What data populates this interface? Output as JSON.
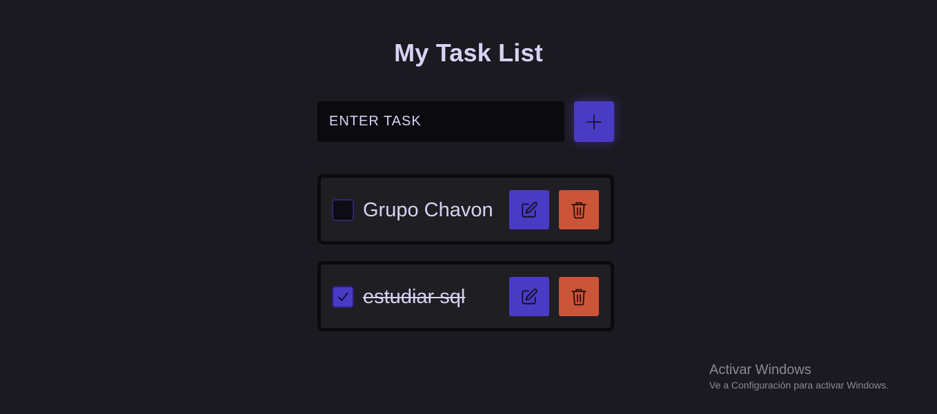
{
  "header": {
    "title": "My Task List"
  },
  "add_task": {
    "placeholder": "ENTER TASK",
    "add_icon": "plus-icon"
  },
  "tasks": [
    {
      "label": "Grupo Chavon",
      "completed": false,
      "edit_icon": "pencil-square-icon",
      "delete_icon": "trash-icon"
    },
    {
      "label": "estudiar sql",
      "completed": true,
      "edit_icon": "pencil-square-icon",
      "delete_icon": "trash-icon"
    }
  ],
  "watermark": {
    "title": "Activar Windows",
    "subtitle": "Ve a Configuración para activar Windows."
  },
  "colors": {
    "background": "#1b1a20",
    "accent": "#4a3bc4",
    "danger": "#cc5439",
    "text": "#d6d3f3"
  }
}
